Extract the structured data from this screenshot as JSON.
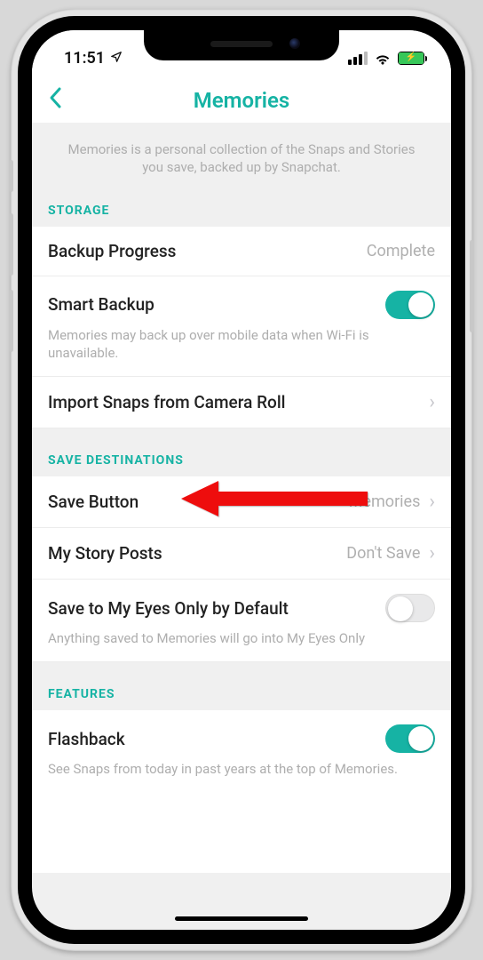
{
  "status": {
    "time": "11:51"
  },
  "nav": {
    "title": "Memories"
  },
  "intro": "Memories is a personal collection of the Snaps and Stories you save, backed up by Snapchat.",
  "sections": {
    "storage": {
      "header": "STORAGE",
      "backup_progress": {
        "label": "Backup Progress",
        "value": "Complete"
      },
      "smart_backup": {
        "label": "Smart Backup",
        "sub": "Memories may back up over mobile data when Wi-Fi is unavailable.",
        "on": true
      },
      "import": {
        "label": "Import Snaps from Camera Roll"
      }
    },
    "save_dest": {
      "header": "SAVE DESTINATIONS",
      "save_button": {
        "label": "Save Button",
        "value": "Memories"
      },
      "my_story": {
        "label": "My Story Posts",
        "value": "Don't Save"
      },
      "eyes_only": {
        "label": "Save to My Eyes Only by Default",
        "sub": "Anything saved to Memories will go into My Eyes Only",
        "on": false
      }
    },
    "features": {
      "header": "FEATURES",
      "flashback": {
        "label": "Flashback",
        "sub": "See Snaps from today in past years at the top of Memories.",
        "on": true
      }
    }
  },
  "colors": {
    "accent": "#16b3a4"
  }
}
